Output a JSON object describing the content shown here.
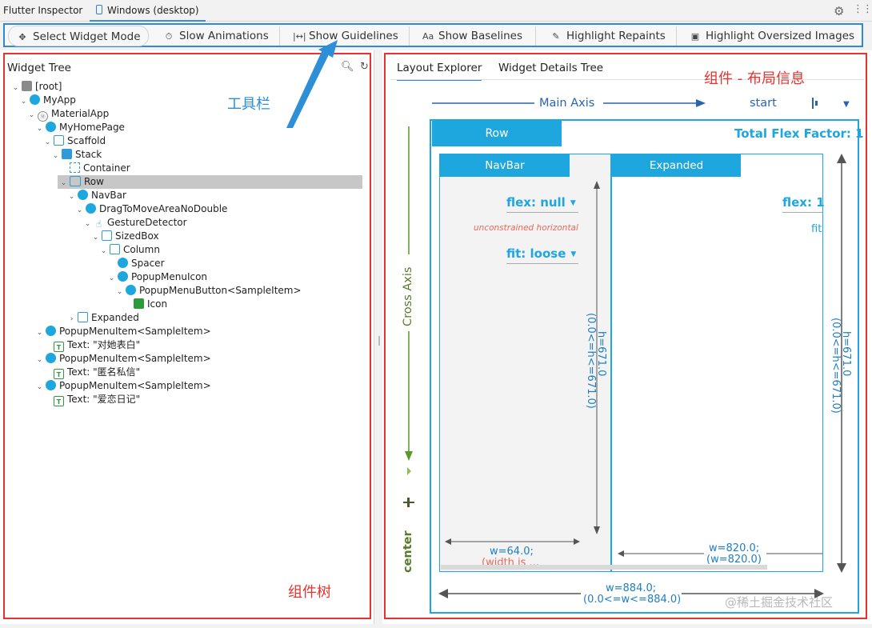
{
  "topbar": {
    "app_title": "Flutter Inspector",
    "device_tab": "Windows (desktop)",
    "settings_icon": "gear-icon",
    "more_icon": "more-icon"
  },
  "toolbar": {
    "buttons": [
      {
        "label": "Select Widget Mode",
        "icon": "pointer-icon"
      },
      {
        "label": "Slow Animations",
        "icon": "timer-icon"
      },
      {
        "label": "Show Guidelines",
        "icon": "guidelines-icon"
      },
      {
        "label": "Show Baselines",
        "icon": "baseline-icon"
      },
      {
        "label": "Highlight Repaints",
        "icon": "brush-icon"
      },
      {
        "label": "Highlight Oversized Images",
        "icon": "image-icon"
      }
    ]
  },
  "annotations": {
    "toolbar": "工具栏",
    "tree": "组件树",
    "layout": "组件 - 布局信息"
  },
  "widget_tree": {
    "title": "Widget Tree",
    "search_icon": "search-icon",
    "refresh_icon": "refresh-icon",
    "selected": "Row",
    "nodes": [
      {
        "label": "[root]",
        "depth": 0,
        "expanded": true,
        "icon": "folder"
      },
      {
        "label": "MyApp",
        "depth": 1,
        "expanded": true,
        "icon": "blue"
      },
      {
        "label": "MaterialApp",
        "depth": 2,
        "expanded": true,
        "icon": "gray"
      },
      {
        "label": "MyHomePage",
        "depth": 3,
        "expanded": true,
        "icon": "blue"
      },
      {
        "label": "Scaffold",
        "depth": 4,
        "expanded": true,
        "icon": "scaffold"
      },
      {
        "label": "Stack",
        "depth": 5,
        "expanded": true,
        "icon": "stack"
      },
      {
        "label": "Container",
        "depth": 6,
        "expanded": null,
        "icon": "dash"
      },
      {
        "label": "Row",
        "depth": 6,
        "expanded": true,
        "icon": "row"
      },
      {
        "label": "NavBar",
        "depth": 7,
        "expanded": true,
        "icon": "blue"
      },
      {
        "label": "DragToMoveAreaNoDouble",
        "depth": 8,
        "expanded": true,
        "icon": "blue"
      },
      {
        "label": "GestureDetector",
        "depth": 9,
        "expanded": true,
        "icon": "hand"
      },
      {
        "label": "SizedBox",
        "depth": 10,
        "expanded": true,
        "icon": "sq"
      },
      {
        "label": "Column",
        "depth": 11,
        "expanded": true,
        "icon": "sq"
      },
      {
        "label": "Spacer",
        "depth": 12,
        "expanded": null,
        "icon": "blue"
      },
      {
        "label": "PopupMenuIcon",
        "depth": 12,
        "expanded": true,
        "icon": "blue"
      },
      {
        "label": "PopupMenuButton<SampleItem>",
        "depth": 13,
        "expanded": true,
        "icon": "blue"
      },
      {
        "label": "Icon",
        "depth": 14,
        "expanded": null,
        "icon": "img"
      },
      {
        "label": "Expanded",
        "depth": 7,
        "expanded": false,
        "icon": "sq"
      },
      {
        "label": "PopupMenuItem<SampleItem>",
        "depth": 3,
        "expanded": true,
        "icon": "blue"
      },
      {
        "label": "Text: \"对她表白\"",
        "depth": 4,
        "expanded": null,
        "icon": "text"
      },
      {
        "label": "PopupMenuItem<SampleItem>",
        "depth": 3,
        "expanded": true,
        "icon": "blue"
      },
      {
        "label": "Text: \"匿名私信\"",
        "depth": 4,
        "expanded": null,
        "icon": "text"
      },
      {
        "label": "PopupMenuItem<SampleItem>",
        "depth": 3,
        "expanded": true,
        "icon": "blue"
      },
      {
        "label": "Text: \"爱恋日记\"",
        "depth": 4,
        "expanded": null,
        "icon": "text"
      }
    ]
  },
  "layout_explorer": {
    "tabs": [
      "Layout Explorer",
      "Widget Details Tree"
    ],
    "main_axis_label": "Main Axis",
    "main_axis_value": "start",
    "cross_axis_label": "Cross Axis",
    "cross_axis_value": "center",
    "row_label": "Row",
    "total_flex_factor": "Total Flex Factor: 1",
    "children": [
      {
        "name": "NavBar",
        "flex": "flex: null",
        "fit": "fit: loose",
        "constraint_note": "unconstrained horizontal",
        "height": "h=671.0",
        "height_constraint": "(0.0<=h<=671.0)",
        "width": "w=64.0;",
        "width_note": "(width is ..."
      },
      {
        "name": "Expanded",
        "flex": "flex: 1",
        "fit": "fit",
        "width": "w=820.0;",
        "width_constraint": "(w=820.0)"
      }
    ],
    "row_height": "h=671.0",
    "row_height_constraint": "(0.0<=h<=671.0)",
    "row_width": "w=884.0;",
    "row_width_constraint": "(0.0<=w<=884.0)"
  },
  "watermark": "@稀土掘金技术社区"
}
